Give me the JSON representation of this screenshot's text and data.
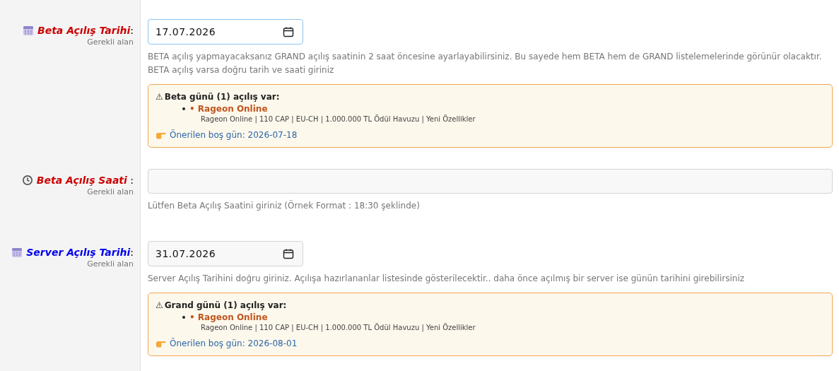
{
  "fields": [
    {
      "label": "Beta Açılış Tarihi",
      "colon": ":",
      "color": "#cc0000",
      "required": "Gerekli alan",
      "kind": "date",
      "value": "17.07.2026",
      "focused": true,
      "help": "BETA açılış yapmayacaksanız GRAND açılış saatinin 2 saat öncesine ayarlayabilirsiniz. Bu sayede hem BETA hem de GRAND listelemelerinde görünür olacaktır. BETA açılış varsa doğru tarih ve saati giriniz",
      "notice": {
        "warning_glyph": "⚠",
        "title": "Beta günü (1) açılış var:",
        "items": [
          {
            "name": "• Rageon Online",
            "details": "Rageon Online | 110 CAP | EU-CH | 1.000.000 TL Ödül Havuzu | Yeni Özellikler"
          }
        ],
        "suggestion": "Önerilen boş gün: 2026-07-18"
      }
    },
    {
      "label": "Beta Açılış Saati",
      "colon": " :",
      "color": "#cc0000",
      "required": "Gerekli alan",
      "kind": "text",
      "focused": false,
      "help": "Lütfen Beta Açılış Saatini giriniz (Örnek Format : 18:30 şeklinde)"
    },
    {
      "label": "Server Açılış Tarihi",
      "colon": ":",
      "color": "#0000ee",
      "required": "Gerekli alan",
      "kind": "date",
      "value": "31.07.2026",
      "focused": false,
      "help": "Server Açılış Tarihini doğru giriniz. Açılışa hazırlananlar listesinde gösterilecektir.. daha önce açılmış bir server ise günün tarihini girebilirsiniz",
      "notice": {
        "warning_glyph": "⚠",
        "title": "Grand günü (1) açılış var:",
        "items": [
          {
            "name": "• Rageon Online",
            "details": "Rageon Online | 110 CAP | EU-CH | 1.000.000 TL Ödül Havuzu | Yeni Özellikler"
          }
        ],
        "suggestion": "Önerilen boş gün: 2026-08-01"
      }
    }
  ]
}
